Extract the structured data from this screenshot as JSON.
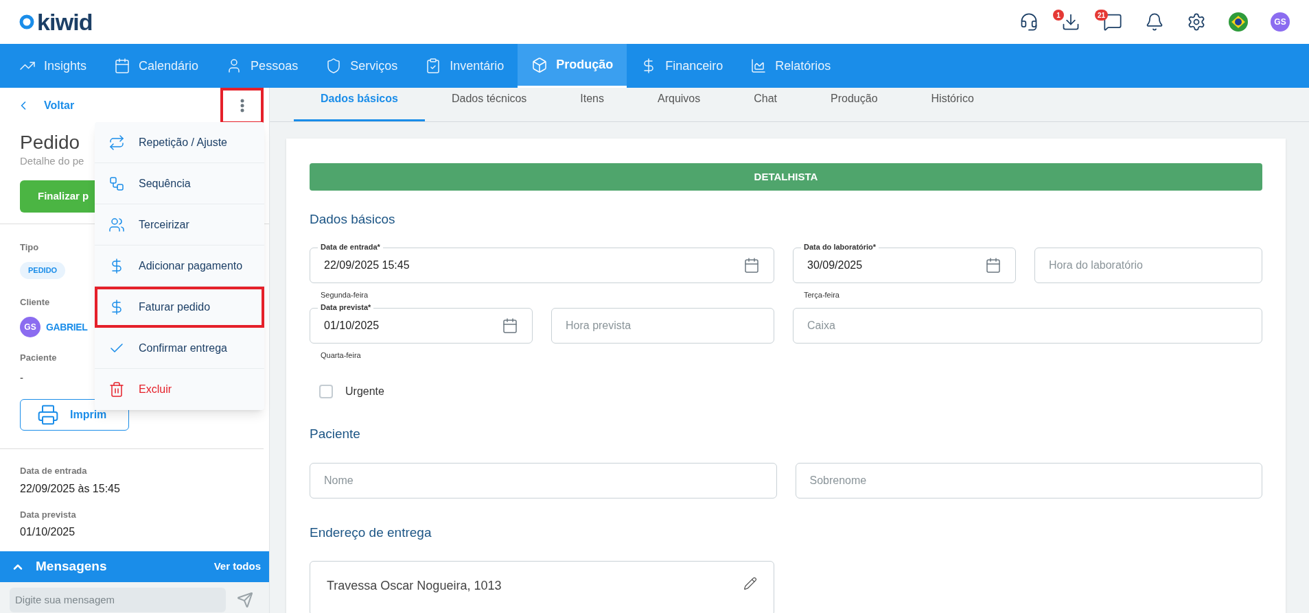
{
  "header": {
    "logo": "kiwid",
    "download_badge": "1",
    "chat_badge": "21",
    "avatar": "GS"
  },
  "nav": [
    {
      "label": "Insights",
      "selected": false
    },
    {
      "label": "Calendário",
      "selected": false
    },
    {
      "label": "Pessoas",
      "selected": false
    },
    {
      "label": "Serviços",
      "selected": false
    },
    {
      "label": "Inventário",
      "selected": false
    },
    {
      "label": "Produção",
      "selected": true
    },
    {
      "label": "Financeiro",
      "selected": false
    },
    {
      "label": "Relatórios",
      "selected": false
    }
  ],
  "sidebar": {
    "back": "Voltar",
    "more_button_highlighted": true,
    "title": "Pedido",
    "subtitle": "Detalhe do pe",
    "finish_button": "Finalizar p",
    "type_label": "Tipo",
    "type_badge": "PEDIDO",
    "client_label": "Cliente",
    "client_avatar": "GS",
    "client_name": "GABRIEL",
    "patient_label": "Paciente",
    "patient_value": "-",
    "print_button": "Imprim",
    "dates": [
      {
        "label": "Data de entrada",
        "value": "22/09/2025 às 15:45"
      },
      {
        "label": "Data prevista",
        "value": "01/10/2025"
      }
    ],
    "messages": {
      "title": "Mensagens",
      "expanded": true,
      "see_all": "Ver todos",
      "placeholder": "Digite sua mensagem"
    }
  },
  "menu": [
    {
      "label": "Repetição / Ajuste",
      "kind": "normal",
      "highlighted": false
    },
    {
      "label": "Sequência",
      "kind": "normal",
      "highlighted": false
    },
    {
      "label": "Terceirizar",
      "kind": "normal",
      "highlighted": false
    },
    {
      "label": "Adicionar pagamento",
      "kind": "normal",
      "highlighted": false
    },
    {
      "label": "Faturar pedido",
      "kind": "normal",
      "highlighted": true
    },
    {
      "label": "Confirmar entrega",
      "kind": "normal",
      "highlighted": false
    },
    {
      "label": "Excluir",
      "kind": "danger",
      "highlighted": false
    }
  ],
  "tabs": [
    {
      "label": "Dados básicos",
      "selected": true
    },
    {
      "label": "Dados técnicos",
      "selected": false
    },
    {
      "label": "Itens",
      "selected": false
    },
    {
      "label": "Arquivos",
      "selected": false
    },
    {
      "label": "Chat",
      "selected": false
    },
    {
      "label": "Produção",
      "selected": false
    },
    {
      "label": "Histórico",
      "selected": false
    }
  ],
  "form": {
    "banner": "DETALHISTA",
    "basic_heading": "Dados básicos",
    "row_1": [
      {
        "kind": "date",
        "label": "Data de entrada*",
        "value": "22/09/2025 15:45",
        "helper": "Segunda-feira"
      },
      {
        "kind": "date",
        "label": "Data do laboratório*",
        "value": "30/09/2025",
        "helper": "Terça-feira"
      },
      {
        "kind": "text",
        "placeholder": "Hora do laboratório"
      }
    ],
    "row_2": [
      {
        "kind": "date",
        "label": "Data prevista*",
        "value": "01/10/2025",
        "helper": "Quarta-feira"
      },
      {
        "kind": "text",
        "placeholder": "Hora prevista"
      },
      {
        "kind": "text",
        "placeholder": "Caixa"
      }
    ],
    "urgent": {
      "label": "Urgente",
      "checked": false
    },
    "patient_heading": "Paciente",
    "patient_fields": [
      {
        "placeholder": "Nome"
      },
      {
        "placeholder": "Sobrenome"
      }
    ],
    "address_heading": "Endereço de entrega",
    "address": "Travessa Oscar Nogueira, 1013"
  }
}
